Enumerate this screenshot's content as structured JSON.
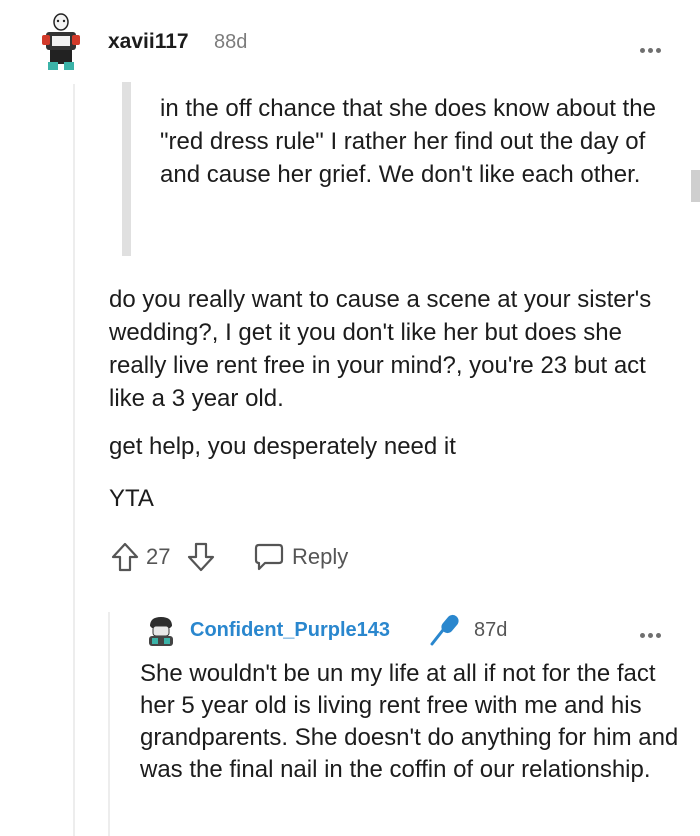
{
  "comment": {
    "username": "xavii117",
    "age": "88d",
    "quote": "in the off chance that she does know about the \"red dress rule\" I rather her find out the day of and cause her grief. We don't like each other.",
    "paragraphs": [
      "do you really want to cause a scene at your sister's wedding?, I get it you don't like her but does she really live rent free in your mind?, you're 23 but act like a 3 year old.",
      "get help, you desperately need it",
      "YTA"
    ],
    "votes": "27",
    "reply_label": "Reply"
  },
  "reply": {
    "username": "Confident_Purple143",
    "age": "87d",
    "text": "She wouldn't be un my life at all if not for the fact her 5 year old is living rent free with me and his grandparents. She doesn't do anything for him and was the final nail in the coffin of our relationship."
  },
  "colors": {
    "reply_username": "#2a87ce",
    "mic_icon": "#2a87ce"
  },
  "icons": [
    "user-avatar-icon",
    "more-options-icon",
    "upvote-icon",
    "downvote-icon",
    "reply-icon",
    "microphone-icon"
  ]
}
